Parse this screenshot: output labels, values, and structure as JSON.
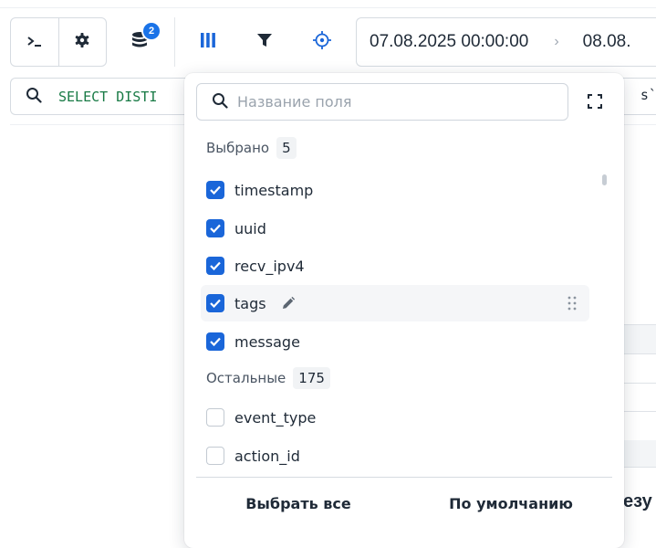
{
  "toolbar": {
    "terminal_icon": "terminal-icon",
    "settings_icon": "gear-icon",
    "sources_icon": "database-icon",
    "sources_badge": "2",
    "columns_icon": "columns-icon",
    "filter_icon": "filter-icon",
    "target_icon": "crosshair-icon"
  },
  "date_range": {
    "from": "07.08.2025 00:00:00",
    "separator": "›",
    "to": "08.08."
  },
  "query": {
    "text": "SELECT DISTI",
    "tail": "s`,"
  },
  "background": {
    "result_fragment": "езу"
  },
  "field_picker": {
    "search_placeholder": "Название поля",
    "selected_label": "Выбрано",
    "selected_count": "5",
    "selected_fields": [
      {
        "name": "timestamp"
      },
      {
        "name": "uuid"
      },
      {
        "name": "recv_ipv4"
      },
      {
        "name": "tags"
      },
      {
        "name": "message"
      }
    ],
    "other_label": "Остальные",
    "other_count": "175",
    "other_fields": [
      {
        "name": "event_type"
      },
      {
        "name": "action_id"
      }
    ],
    "select_all_label": "Выбрать все",
    "default_label": "По умолчанию"
  },
  "colors": {
    "accent": "#1a66d9",
    "badge": "#1a73e8",
    "query_green": "#187a45"
  }
}
